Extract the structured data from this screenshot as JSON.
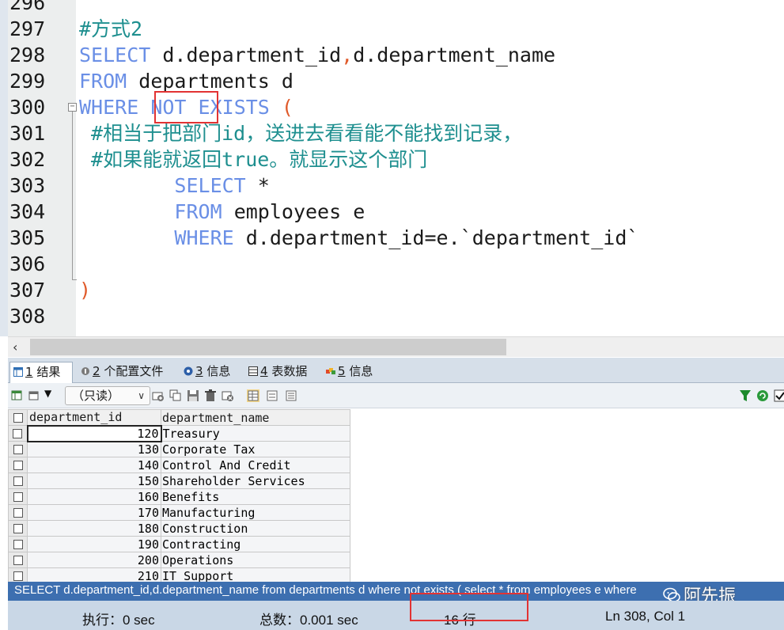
{
  "editor": {
    "lines": [
      {
        "num": "296",
        "parts": []
      },
      {
        "num": "297",
        "parts": [
          {
            "t": "#方式2",
            "c": "cm"
          }
        ]
      },
      {
        "num": "298",
        "parts": [
          {
            "t": "SELECT",
            "c": "kw"
          },
          {
            "t": " d.department_id",
            "c": ""
          },
          {
            "t": ",",
            "c": "pun"
          },
          {
            "t": "d.department_name",
            "c": ""
          }
        ]
      },
      {
        "num": "299",
        "parts": [
          {
            "t": "FROM",
            "c": "kw"
          },
          {
            "t": " departments d",
            "c": ""
          }
        ]
      },
      {
        "num": "300",
        "parts": [
          {
            "t": "WHERE",
            "c": "kw"
          },
          {
            "t": " ",
            "c": ""
          },
          {
            "t": "NOT",
            "c": "kw"
          },
          {
            "t": " ",
            "c": ""
          },
          {
            "t": "EXISTS",
            "c": "kw"
          },
          {
            "t": " (",
            "c": "pun"
          }
        ]
      },
      {
        "num": "301",
        "parts": [
          {
            "t": " #相当于把部门id，送进去看看能不能找到记录，",
            "c": "cm"
          }
        ]
      },
      {
        "num": "302",
        "parts": [
          {
            "t": " #如果能就返回true。就显示这个部门",
            "c": "cm"
          }
        ]
      },
      {
        "num": "303",
        "parts": [
          {
            "t": "        ",
            "c": ""
          },
          {
            "t": "SELECT",
            "c": "kw"
          },
          {
            "t": " *",
            "c": ""
          }
        ]
      },
      {
        "num": "304",
        "parts": [
          {
            "t": "        ",
            "c": ""
          },
          {
            "t": "FROM",
            "c": "kw"
          },
          {
            "t": " employees e",
            "c": ""
          }
        ]
      },
      {
        "num": "305",
        "parts": [
          {
            "t": "        ",
            "c": ""
          },
          {
            "t": "WHERE",
            "c": "kw"
          },
          {
            "t": " d.department_id=e.`department_id`",
            "c": ""
          }
        ]
      },
      {
        "num": "306",
        "parts": []
      },
      {
        "num": "307",
        "parts": [
          {
            "t": ")",
            "c": "pun"
          }
        ]
      },
      {
        "num": "308",
        "parts": []
      }
    ]
  },
  "tabs": [
    {
      "num": "1",
      "label": "结果",
      "active": true,
      "icon": "result-grid-icon"
    },
    {
      "num": "2",
      "label": "个配置文件",
      "active": false,
      "icon": "profile-icon"
    },
    {
      "num": "3",
      "label": "信息",
      "active": false,
      "icon": "info-icon"
    },
    {
      "num": "4",
      "label": "表数据",
      "active": false,
      "icon": "table-data-icon"
    },
    {
      "num": "5",
      "label": "信息",
      "active": false,
      "icon": "info-colored-icon"
    }
  ],
  "toolbar": {
    "readonly_label": "（只读）"
  },
  "grid": {
    "columns": [
      "department_id",
      "department_name"
    ],
    "rows": [
      [
        "120",
        "Treasury"
      ],
      [
        "130",
        "Corporate Tax"
      ],
      [
        "140",
        "Control And Credit"
      ],
      [
        "150",
        "Shareholder Services"
      ],
      [
        "160",
        "Benefits"
      ],
      [
        "170",
        "Manufacturing"
      ],
      [
        "180",
        "Construction"
      ],
      [
        "190",
        "Contracting"
      ],
      [
        "200",
        "Operations"
      ],
      [
        "210",
        "IT Support"
      ]
    ]
  },
  "sqlbar": {
    "text": "SELECT d.department_id,d.department_name from departments d where not exists ( select * from employees e where"
  },
  "watermark": {
    "text": "阿先振"
  },
  "status": {
    "exec": "执行：0 sec",
    "total": "总数：0.001 sec",
    "rows": "16 行",
    "position": "Ln 308, Col 1"
  },
  "colors": {
    "keyword": "#6a8fe6",
    "comment": "#1e8f8f",
    "highlight_box": "#e23333",
    "sqlbar_bg": "#3d6fb0",
    "statusbar_bg": "#c9d7e6"
  }
}
